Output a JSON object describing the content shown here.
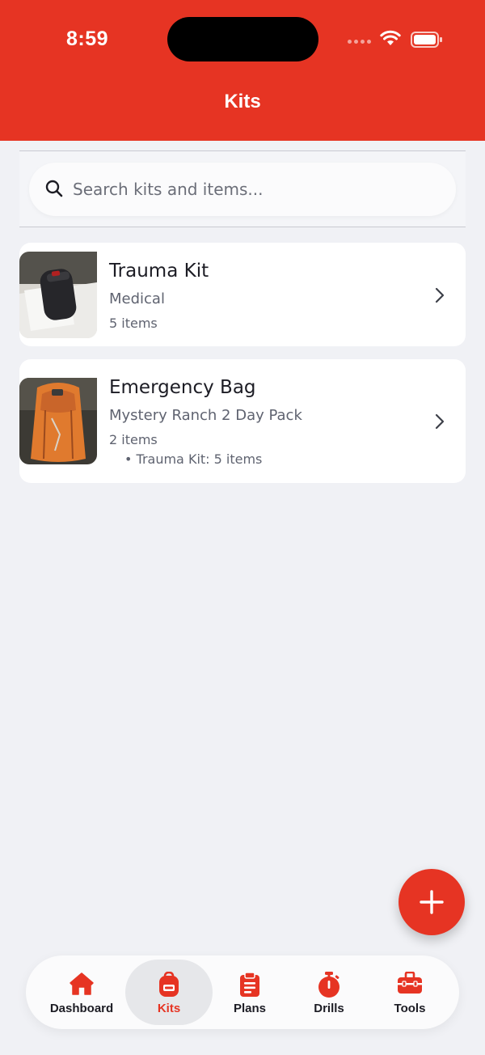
{
  "status_bar": {
    "time": "8:59"
  },
  "header": {
    "title": "Kits"
  },
  "search": {
    "placeholder": "Search kits and items..."
  },
  "kits": [
    {
      "name": "Trauma Kit",
      "subtitle": "Medical",
      "count": "5 items"
    },
    {
      "name": "Emergency Bag",
      "subtitle": "Mystery Ranch 2 Day Pack",
      "count": "2 items",
      "nested": "• Trauma Kit: 5 items"
    }
  ],
  "tabs": [
    {
      "label": "Dashboard",
      "icon": "home-icon"
    },
    {
      "label": "Kits",
      "icon": "backpack-icon",
      "active": true
    },
    {
      "label": "Plans",
      "icon": "clipboard-icon"
    },
    {
      "label": "Drills",
      "icon": "stopwatch-icon"
    },
    {
      "label": "Tools",
      "icon": "toolbox-icon"
    }
  ],
  "colors": {
    "accent": "#e63423",
    "background": "#f0f1f5",
    "card": "#ffffff"
  },
  "icons": [
    "search-icon",
    "chevron-right-icon",
    "plus-icon",
    "wifi-icon",
    "battery-icon"
  ]
}
